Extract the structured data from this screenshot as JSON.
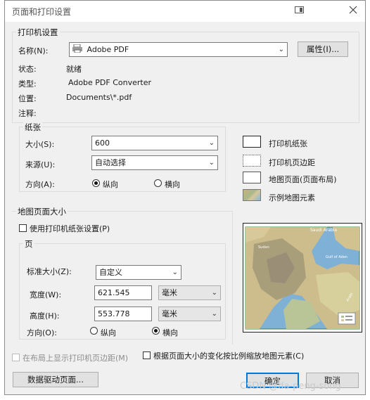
{
  "window": {
    "title": "页面和打印设置"
  },
  "printer": {
    "group_label": "打印机设置",
    "name_label": "名称(N):",
    "name_value": "Adobe PDF",
    "properties_button": "属性(I)...",
    "status_label": "状态:",
    "status_value": "就绪",
    "type_label": "类型:",
    "type_value": "Adobe PDF Converter",
    "location_label": "位置:",
    "location_value": "Documents\\*.pdf",
    "comment_label": "注释:"
  },
  "paper": {
    "group_label": "纸张",
    "size_label": "大小(S):",
    "size_value": "600",
    "source_label": "来源(U):",
    "source_value": "自动选择",
    "orientation_label": "方向(A):",
    "portrait": "纵向",
    "landscape": "横向",
    "selected": "portrait"
  },
  "legend": [
    {
      "label": "打印机纸张",
      "style": "solid"
    },
    {
      "label": "打印机页边距",
      "style": "dotted"
    },
    {
      "label": "地图页面(页面布局)",
      "style": "plain"
    },
    {
      "label": "示例地图元素",
      "style": "map"
    }
  ],
  "map_page": {
    "group_label": "地图页面大小",
    "use_printer_paper": "使用打印机纸张设置(P)",
    "page_label": "页",
    "standard_size_label": "标准大小(Z):",
    "standard_size_value": "自定义",
    "width_label": "宽度(W):",
    "width_value": "621.545",
    "width_unit": "毫米",
    "height_label": "高度(H):",
    "height_value": "553.778",
    "height_unit": "毫米",
    "orientation_label": "方向(O):",
    "portrait": "纵向",
    "landscape": "横向",
    "selected": "landscape"
  },
  "preview": {
    "map_texts": [
      "Saudi Arabia",
      "Gulf of Aden",
      "Sudan",
      "Arabi"
    ]
  },
  "options": {
    "show_margins": "在布局上显示打印机页边距(M)",
    "scale_elements": "根据页面大小的变化按比例缩放地图元素(C)"
  },
  "buttons": {
    "data_driven": "数据驱动页面...",
    "ok": "确定",
    "cancel": "取消"
  },
  "watermark": "CSDN @da-peng-song",
  "colors": {
    "accent": "#0078d7",
    "dialog_bg": "#f0f0f0"
  }
}
